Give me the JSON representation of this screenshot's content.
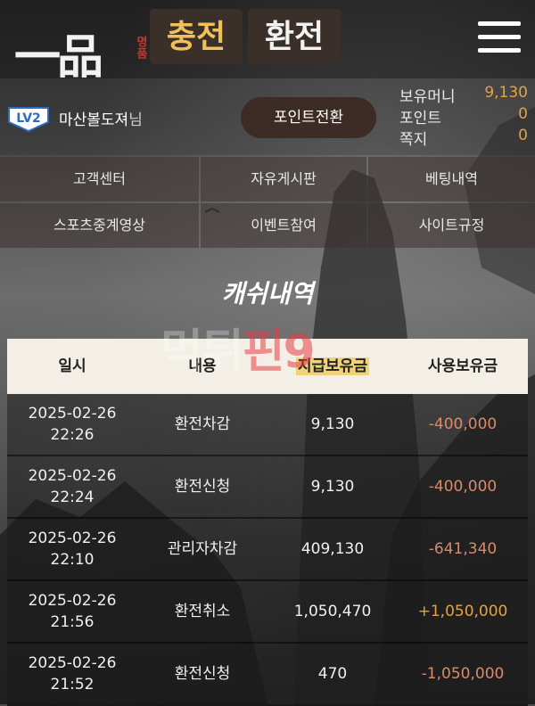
{
  "header": {
    "logo_text": "一品",
    "logo_sub": "명품",
    "charge_label": "충전",
    "exchange_label": "환전",
    "menu_icon": "hamburger-menu-icon"
  },
  "user": {
    "level": "LV2",
    "name": "마산볼도져",
    "suffix": "님",
    "point_convert_label": "포인트전환",
    "stats": [
      {
        "label": "보유머니",
        "value": "9,130"
      },
      {
        "label": "포인트",
        "value": "0"
      },
      {
        "label": "쪽지",
        "value": "0"
      }
    ]
  },
  "nav": [
    "고객센터",
    "자유게시판",
    "베팅내역",
    "스포츠중계영상",
    "이벤트참여",
    "사이트규정"
  ],
  "page_title": "캐쉬내역",
  "watermark": {
    "part1": "먹튀",
    "part2": "핀",
    "part3": "9"
  },
  "table": {
    "headers": [
      "일시",
      "내용",
      "지급보유금",
      "사용보유금"
    ],
    "rows": [
      {
        "date": "2025-02-26",
        "time": "22:26",
        "content": "환전차감",
        "remain": "9,130",
        "used": "-400,000"
      },
      {
        "date": "2025-02-26",
        "time": "22:24",
        "content": "환전신청",
        "remain": "9,130",
        "used": "-400,000"
      },
      {
        "date": "2025-02-26",
        "time": "22:10",
        "content": "관리자차감",
        "remain": "409,130",
        "used": "-641,340"
      },
      {
        "date": "2025-02-26",
        "time": "21:56",
        "content": "환전취소",
        "remain": "1,050,470",
        "used": "+1,050,000"
      },
      {
        "date": "2025-02-26",
        "time": "21:52",
        "content": "환전신청",
        "remain": "470",
        "used": "-1,050,000"
      }
    ]
  },
  "colors": {
    "accent_gold": "#f0c15a",
    "value_orange": "#e8a23c",
    "negative": "#d98a6a"
  }
}
